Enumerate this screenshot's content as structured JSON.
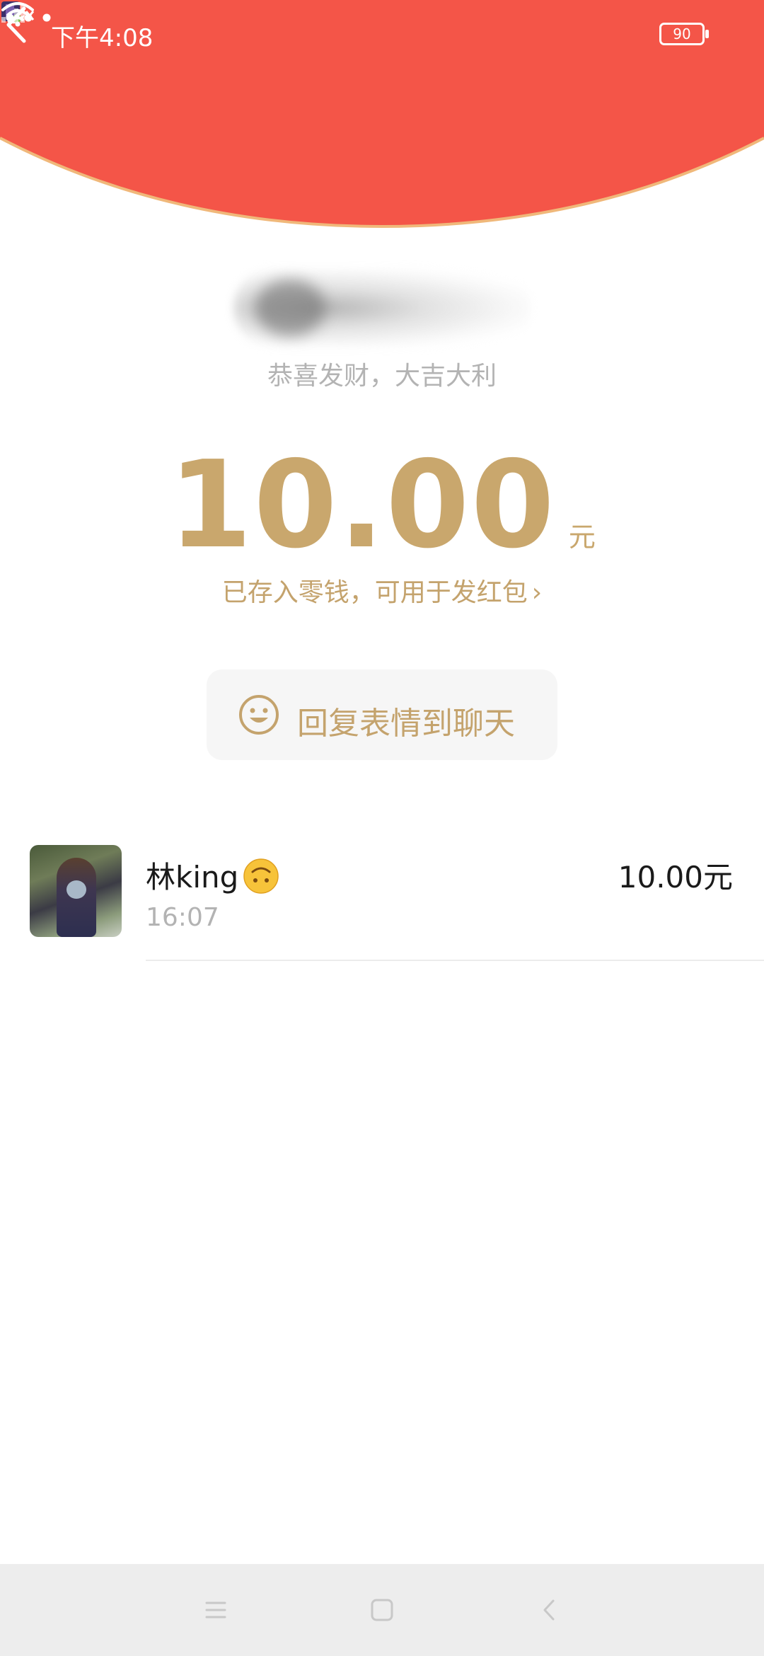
{
  "status_bar": {
    "time": "下午4:08",
    "battery": "90",
    "icons": [
      "moon-icon",
      "app-notification-icon",
      "signal-icon",
      "wifi-icon",
      "battery-icon"
    ]
  },
  "header": {
    "back_icon": "chevron-left-icon",
    "more_icon": "more-dots-icon",
    "color": "#f45548"
  },
  "packet": {
    "greeting": "恭喜发财，大吉大利",
    "amount": "10.00",
    "unit": "元",
    "deposit_note": "已存入零钱，可用于发红包",
    "deposit_chevron": "›",
    "accent_color": "#c9a76d"
  },
  "reply_button": {
    "label": "回复表情到聊天",
    "icon": "smile-icon"
  },
  "records": [
    {
      "name": "林king",
      "emoji": "upside-down-face-emoji",
      "time": "16:07",
      "amount": "10.00元"
    }
  ],
  "nav_bar": {
    "buttons": [
      "menu-icon",
      "home-icon",
      "back-icon"
    ]
  }
}
